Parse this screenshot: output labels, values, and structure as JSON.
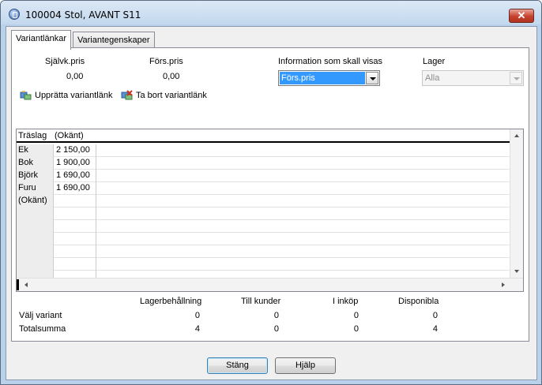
{
  "window": {
    "title": "100004 Stol, AVANT S11",
    "close_symbol": "✕"
  },
  "tabs": [
    {
      "label": "Variantlänkar",
      "active": true
    },
    {
      "label": "Variantegenskaper",
      "active": false
    }
  ],
  "summary": {
    "cost_label": "Självk.pris",
    "cost_value": "0,00",
    "sales_label": "Förs.pris",
    "sales_value": "0,00"
  },
  "info_select": {
    "label": "Information som skall visas",
    "value": "Förs.pris"
  },
  "warehouse_select": {
    "label": "Lager",
    "value": "Alla"
  },
  "toolbar": {
    "create_link_label": "Upprätta variantlänk",
    "remove_link_label": "Ta bort variantlänk"
  },
  "grid": {
    "columns": [
      "Träslag",
      "(Okänt)"
    ],
    "rows": [
      {
        "name": "Ek",
        "value": "2 150,00"
      },
      {
        "name": "Bok",
        "value": "1 900,00"
      },
      {
        "name": "Björk",
        "value": "1 690,00"
      },
      {
        "name": "Furu",
        "value": "1 690,00"
      },
      {
        "name": "(Okänt)",
        "value": ""
      }
    ]
  },
  "stock": {
    "headers": [
      "Lagerbehållning",
      "Till kunder",
      "I inköp",
      "Disponibla"
    ],
    "rows": [
      {
        "label": "Välj variant",
        "values": [
          "0",
          "0",
          "0",
          "0"
        ]
      },
      {
        "label": "Totalsumma",
        "values": [
          "4",
          "0",
          "0",
          "4"
        ]
      }
    ]
  },
  "buttons": {
    "close_label": "Stäng",
    "help_label": "Hjälp"
  },
  "colors": {
    "selection": "#3399ff",
    "accent": "#c6412e"
  }
}
